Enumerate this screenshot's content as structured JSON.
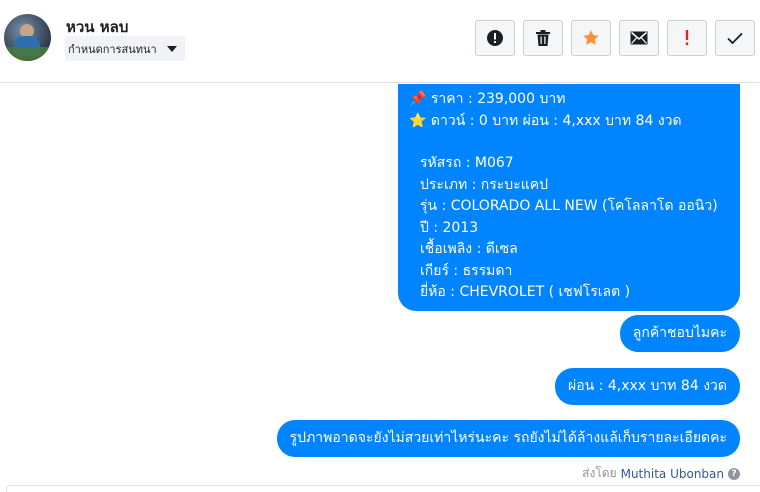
{
  "header": {
    "name": "หวน หลบ",
    "label_select": "กำหนดการสนทนา",
    "actions": [
      {
        "icon": "report-icon"
      },
      {
        "icon": "trash-icon"
      },
      {
        "icon": "star-icon",
        "color": "#f7923b"
      },
      {
        "icon": "envelope-icon"
      },
      {
        "icon": "exclamation-icon",
        "color": "#e02424"
      },
      {
        "icon": "checkmark-icon"
      }
    ]
  },
  "messages": {
    "big": {
      "price": "📌 ราคา : 239,000 บาท",
      "down": "⭐ ดาวน์ : 0 บาท ผ่อน : 4,xxx บาท 84 งวด",
      "code": "รหัสรถ : M067",
      "type": "ประเภท : กระบะแคป",
      "model": "รุ่น : COLORADO ALL NEW (โคโลลาโด ออนิว)",
      "year": "ปี : 2013",
      "fuel": "เชื้อเพลิง : ดีเซล",
      "gear": "เกียร์ : ธรรมดา",
      "brand": "ยี่ห้อ : CHEVROLET ( เชฟโรเลต )"
    },
    "m2": "ลูกค้าชอบไมคะ",
    "m3": "ผ่อน : 4,xxx บาท 84 งวด",
    "m4": "รูปภาพอาดจะยังไม่สวยเท่าไหร่นะคะ รถยังไม่ได้ล้างแล้เก็บรายละเอียดคะ"
  },
  "sent_by": {
    "prefix": "ส่งโดย",
    "user": "Muthita Ubonban",
    "help": "?"
  },
  "colors": {
    "bubble": "#0084ff",
    "border": "#ccd0d5"
  }
}
